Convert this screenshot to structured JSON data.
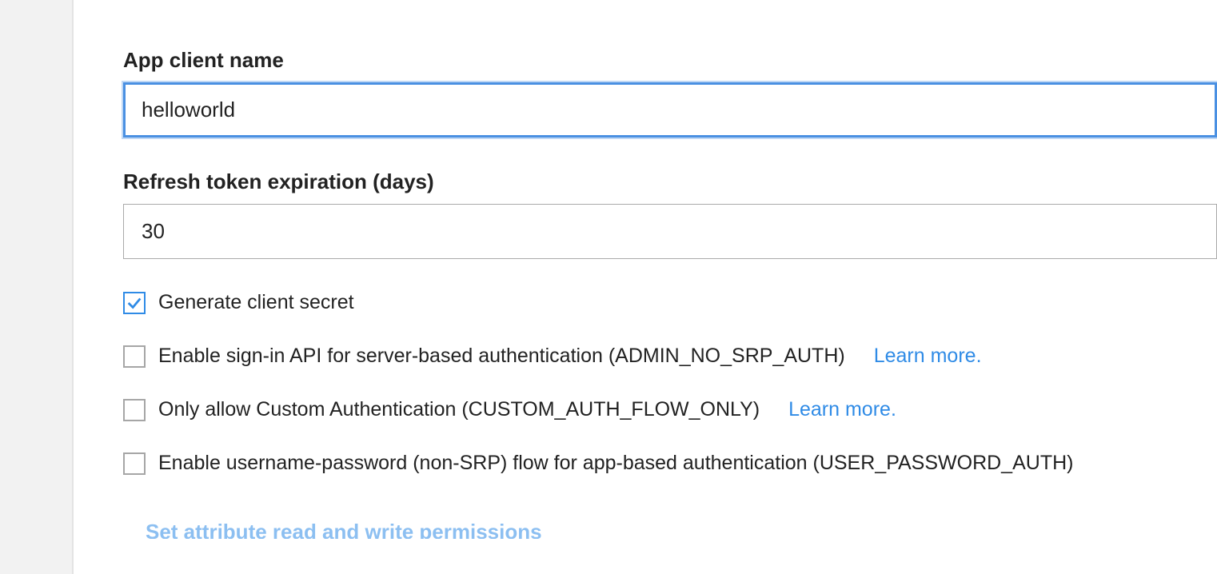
{
  "fields": {
    "app_client_name": {
      "label": "App client name",
      "value": "helloworld"
    },
    "refresh_token_expiration": {
      "label": "Refresh token expiration (days)",
      "value": "30"
    }
  },
  "checkboxes": {
    "generate_secret": {
      "label": "Generate client secret",
      "checked": true
    },
    "admin_no_srp": {
      "label": "Enable sign-in API for server-based authentication (ADMIN_NO_SRP_AUTH)",
      "checked": false,
      "learn_more": "Learn more."
    },
    "custom_auth": {
      "label": "Only allow Custom Authentication (CUSTOM_AUTH_FLOW_ONLY)",
      "checked": false,
      "learn_more": "Learn more."
    },
    "user_password_auth": {
      "label": "Enable username-password (non-SRP) flow for app-based authentication (USER_PASSWORD_AUTH)",
      "checked": false
    }
  },
  "links": {
    "set_permissions": "Set attribute read and write permissions"
  }
}
